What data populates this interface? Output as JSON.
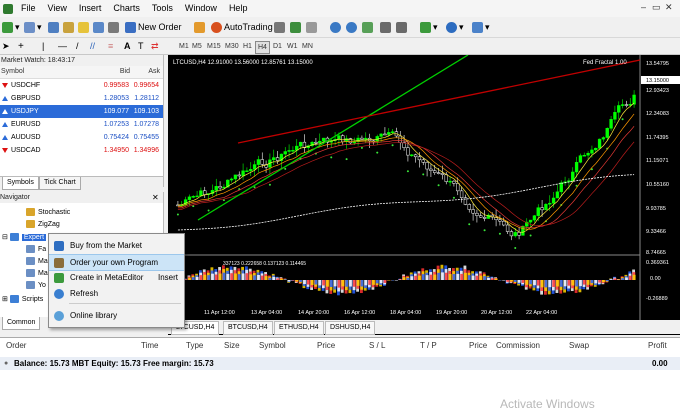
{
  "menu": {
    "items": [
      "File",
      "View",
      "Insert",
      "Charts",
      "Tools",
      "Window",
      "Help"
    ]
  },
  "toolbar": {
    "new_order": "New Order",
    "autotrading": "AutoTrading",
    "timeframes": [
      "M1",
      "M5",
      "M15",
      "M30",
      "H1",
      "H4",
      "D1",
      "W1",
      "MN"
    ],
    "selected_timeframe": "H4"
  },
  "market_watch": {
    "title": "Market Watch: 18:43:17",
    "col_symbol": "Symbol",
    "col_bid": "Bid",
    "col_ask": "Ask",
    "rows": [
      {
        "symbol": "USDCHF",
        "bid": "0.99583",
        "ask": "0.99654",
        "dir": "dn"
      },
      {
        "symbol": "GBPUSD",
        "bid": "1.28053",
        "ask": "1.28112",
        "dir": "up"
      },
      {
        "symbol": "USDJPY",
        "bid": "109.077",
        "ask": "109.103",
        "dir": "up"
      },
      {
        "symbol": "EURUSD",
        "bid": "1.07253",
        "ask": "1.07278",
        "dir": "up"
      },
      {
        "symbol": "AUDUSD",
        "bid": "0.75424",
        "ask": "0.75455",
        "dir": "up"
      },
      {
        "symbol": "USDCAD",
        "bid": "1.34950",
        "ask": "1.34996",
        "dir": "dn"
      }
    ],
    "tabs": [
      "Symbols",
      "Tick Chart"
    ]
  },
  "navigator": {
    "title": "Navigator",
    "items": [
      "Stochastic",
      "ZigZag",
      "Expert Advisors",
      "Scripts"
    ],
    "tabs": [
      "Common"
    ],
    "experts_abbrev": "Expert",
    "sub_abbrev": [
      "Fa",
      "Ma",
      "Ma",
      "Yo"
    ]
  },
  "context_menu": {
    "items": [
      {
        "label": "Buy from the Market",
        "shortcut": ""
      },
      {
        "label": "Order your own Program",
        "shortcut": ""
      },
      {
        "label": "Create in MetaEditor",
        "shortcut": "Insert"
      },
      {
        "label": "Refresh",
        "shortcut": ""
      },
      {
        "label": "Online library",
        "shortcut": ""
      }
    ],
    "highlighted": 1
  },
  "chart": {
    "header": "LTCUSD,H4  12.91000 13.56000 12.85761 13.15000",
    "indicator_name": "Fed Fractal 1.00",
    "osc_header": "337123 0.222658 0.137123 0.114465",
    "price_labels": [
      "13.54795",
      "13.15000",
      "12.93423",
      "12.34083",
      "11.74395",
      "11.15071",
      "10.55160",
      "9.93785",
      "9.33466",
      "8.74665",
      "0.369361",
      "0.00",
      "-0.26889"
    ],
    "time_labels": [
      "2017",
      "11 Apr 12:00",
      "13 Apr 04:00",
      "14 Apr 20:00",
      "16 Apr 12:00",
      "18 Apr 04:00",
      "19 Apr 20:00",
      "20 Apr 12:00",
      "22 Apr 04:00"
    ],
    "colors": {
      "bull": "#00ff00",
      "bear": "#ffffff",
      "trend_green": "#00e000",
      "trend_red": "#c00000"
    }
  },
  "chart_tabs": [
    "LTCUSD,H4",
    "BTCUSD,H4",
    "ETHUSD,H4",
    "DSHUSD,H4"
  ],
  "terminal": {
    "columns": [
      "Order",
      "Time",
      "Type",
      "Size",
      "Symbol",
      "Price",
      "S / L",
      "T / P",
      "Price",
      "Commission",
      "Swap",
      "Profit"
    ],
    "balance_text": "Balance: 15.73 MBT  Equity: 15.73  Free margin: 15.73",
    "profit_total": "0.00"
  },
  "watermark": "Activate Windows"
}
